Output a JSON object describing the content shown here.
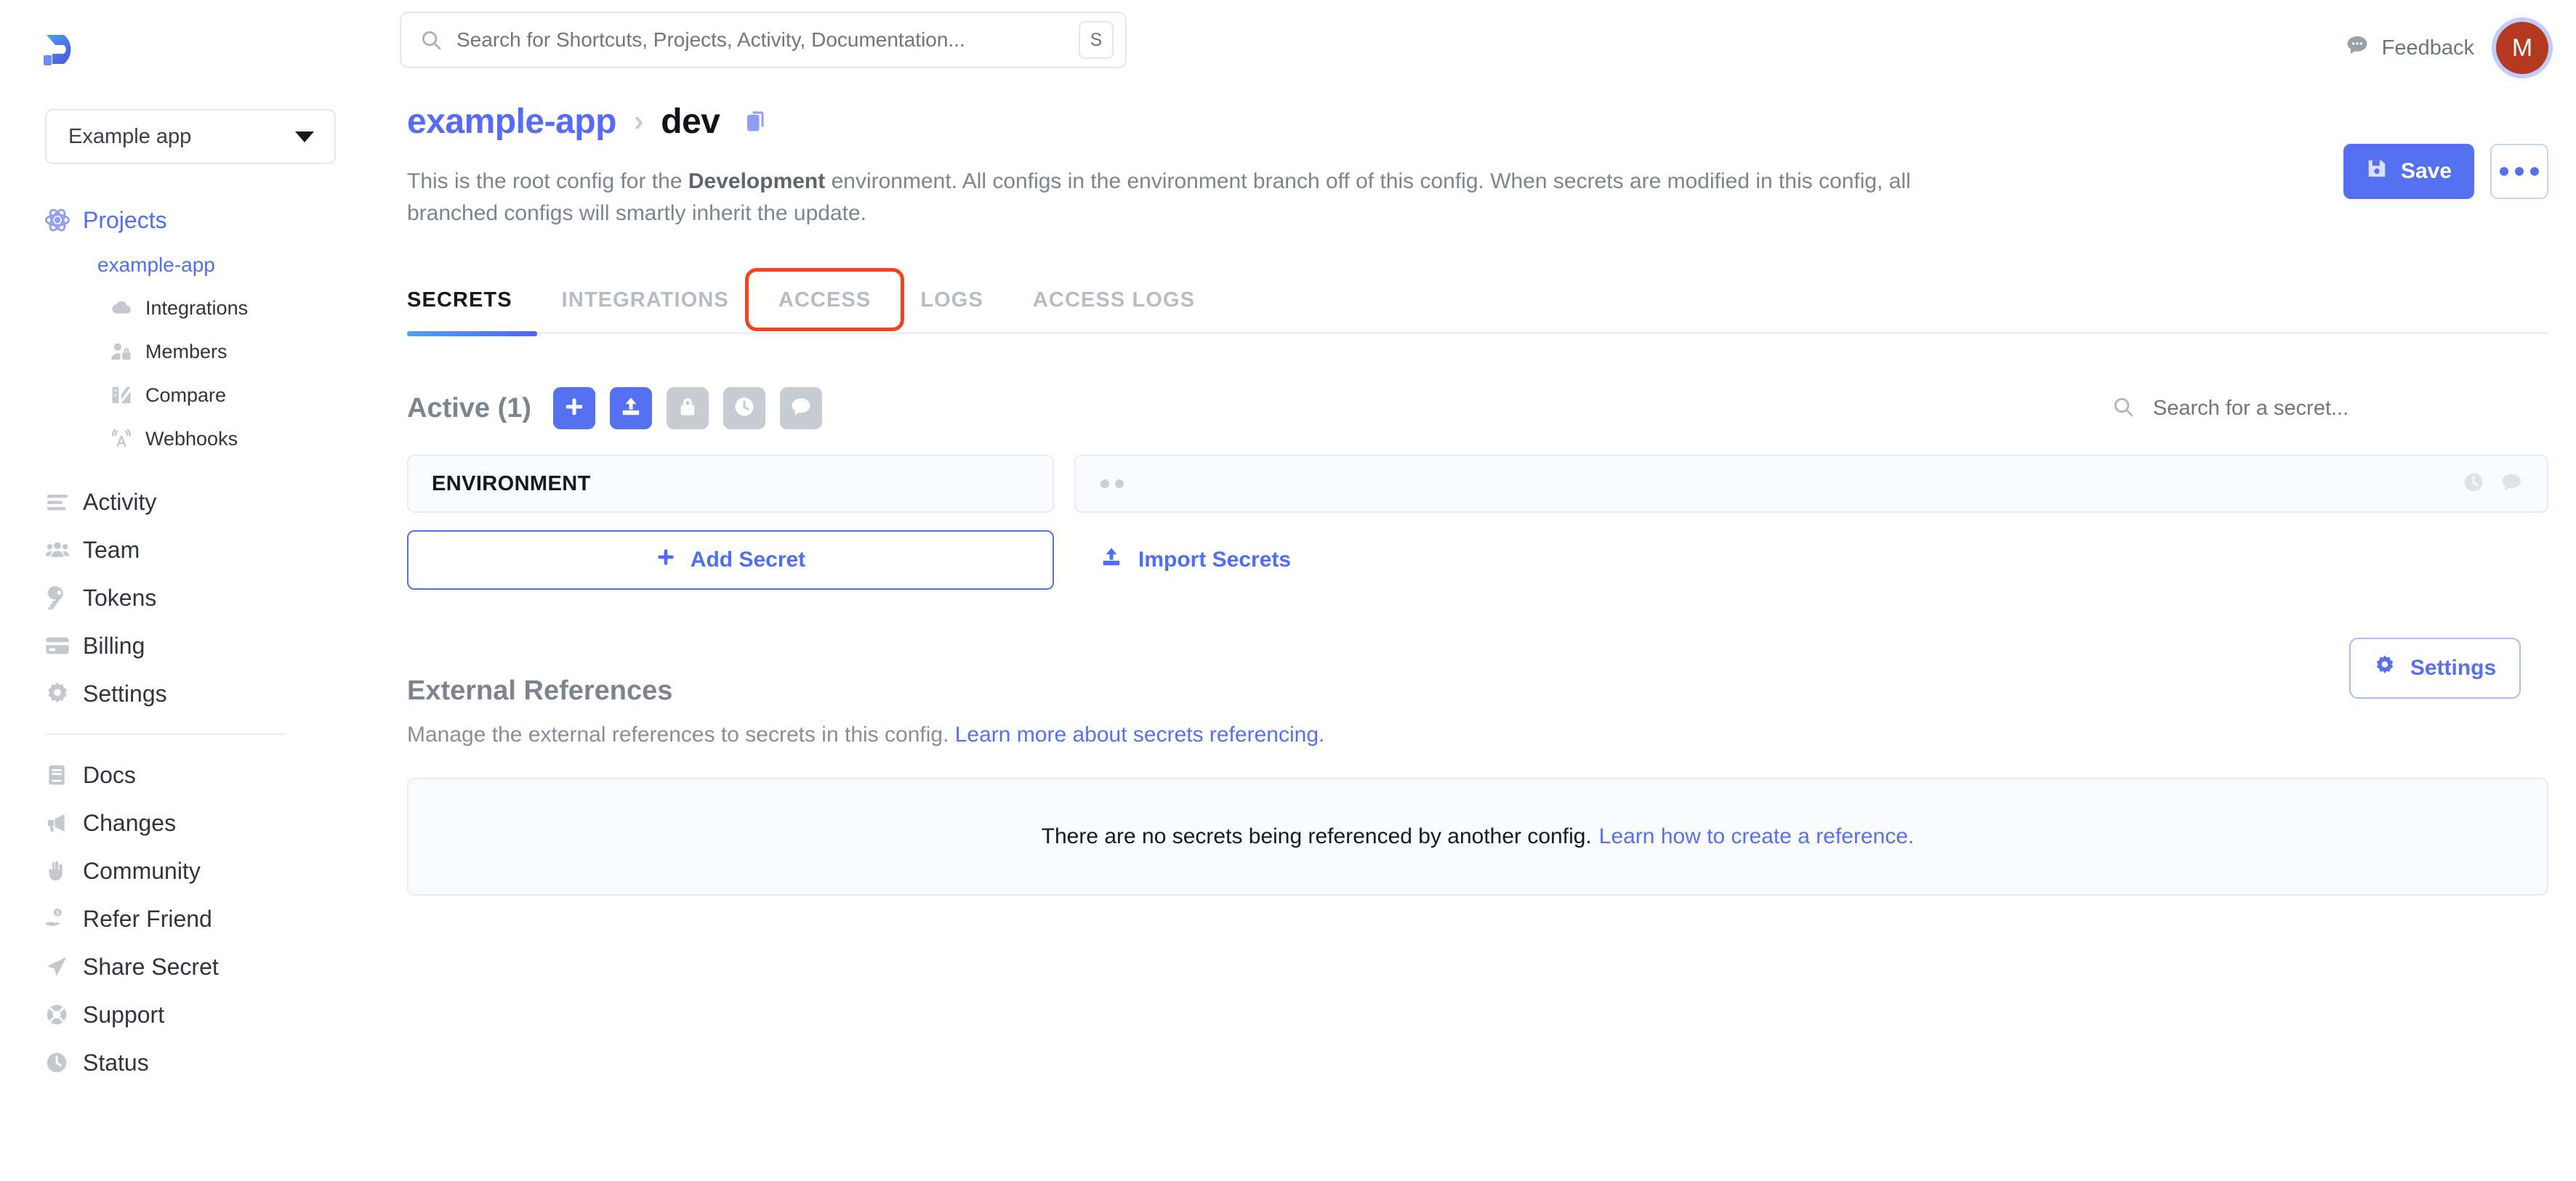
{
  "brand": {
    "logo_alt": "doppler-logo",
    "accent": "#5570f1",
    "highlight": "#f5431f"
  },
  "sidebar": {
    "project_selector": {
      "value": "Example app"
    },
    "primary": [
      {
        "label": "Projects",
        "icon": "atom-icon",
        "accent": true
      },
      {
        "label": "Activity",
        "icon": "list-icon",
        "accent": false
      },
      {
        "label": "Team",
        "icon": "people-icon",
        "accent": false
      },
      {
        "label": "Tokens",
        "icon": "key-icon",
        "accent": false
      },
      {
        "label": "Billing",
        "icon": "credit-card-icon",
        "accent": false
      },
      {
        "label": "Settings",
        "icon": "gear-icon",
        "accent": false
      }
    ],
    "project_name": "example-app",
    "project_children": [
      {
        "label": "Integrations",
        "icon": "cloud-icon"
      },
      {
        "label": "Members",
        "icon": "user-lock-icon"
      },
      {
        "label": "Compare",
        "icon": "compare-icon"
      },
      {
        "label": "Webhooks",
        "icon": "broadcast-icon"
      }
    ],
    "secondary": [
      {
        "label": "Docs",
        "icon": "book-icon"
      },
      {
        "label": "Changes",
        "icon": "megaphone-icon"
      },
      {
        "label": "Community",
        "icon": "hand-peace-icon"
      },
      {
        "label": "Refer Friend",
        "icon": "hand-money-icon"
      },
      {
        "label": "Share Secret",
        "icon": "paper-plane-icon"
      },
      {
        "label": "Support",
        "icon": "lifebuoy-icon"
      },
      {
        "label": "Status",
        "icon": "clock-icon"
      }
    ]
  },
  "topbar": {
    "search_placeholder": "Search for Shortcuts, Projects, Activity, Documentation...",
    "search_value": "",
    "search_shortcut": "S",
    "feedback_label": "Feedback",
    "avatar_initial": "M"
  },
  "header": {
    "breadcrumb_project": "example-app",
    "breadcrumb_separator": "›",
    "breadcrumb_config": "dev",
    "description_prefix": "This is the root config for the ",
    "description_bold": "Development",
    "description_suffix": " environment. All configs in the environment branch off of this config. When secrets are modified in this config, all branched configs will smartly inherit the update.",
    "save_label": "Save"
  },
  "tabs": [
    {
      "label": "SECRETS",
      "active": true,
      "highlighted": false
    },
    {
      "label": "INTEGRATIONS",
      "active": false,
      "highlighted": false
    },
    {
      "label": "ACCESS",
      "active": false,
      "highlighted": true
    },
    {
      "label": "LOGS",
      "active": false,
      "highlighted": false
    },
    {
      "label": "ACCESS LOGS",
      "active": false,
      "highlighted": false
    }
  ],
  "secrets": {
    "section_title": "Active (1)",
    "toolbar": [
      {
        "name": "add-secret-icon-button",
        "icon": "plus-icon",
        "style": "blue"
      },
      {
        "name": "import-secrets-icon-button",
        "icon": "upload-icon",
        "style": "blue"
      },
      {
        "name": "lock-secrets-button",
        "icon": "lock-icon",
        "style": "grey"
      },
      {
        "name": "history-button",
        "icon": "clock-icon",
        "style": "grey"
      },
      {
        "name": "notes-button",
        "icon": "comment-icon",
        "style": "grey"
      }
    ],
    "search_placeholder": "Search for a secret...",
    "search_value": "",
    "rows": [
      {
        "key": "ENVIRONMENT",
        "value_masked": true,
        "value": ""
      }
    ],
    "add_label": "Add Secret",
    "import_label": "Import Secrets"
  },
  "external_references": {
    "title": "External References",
    "description": "Manage the external references to secrets in this config.",
    "description_link": "Learn more about secrets referencing.",
    "settings_label": "Settings",
    "empty_text": "There are no secrets being referenced by another config.",
    "empty_link": "Learn how to create a reference."
  }
}
